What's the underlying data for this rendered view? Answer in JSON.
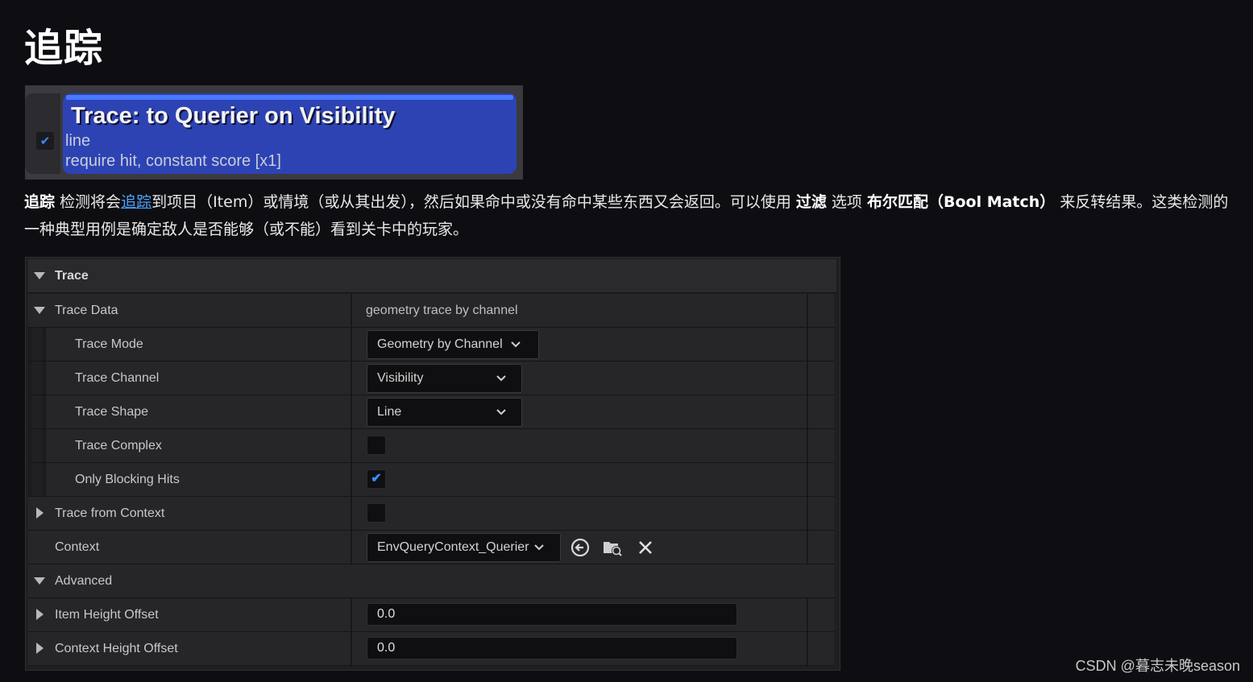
{
  "page": {
    "title": "追踪"
  },
  "node": {
    "title": "Trace: to Querier on Visibility",
    "line1": "line",
    "line2": "require hit, constant score [x1]",
    "checked": true
  },
  "description": {
    "p1": "追踪",
    "p2": " 检测将会",
    "link": "追踪",
    "p3": "到项目（Item）或情境（或从其出发），然后如果命中或没有命中某些东西又会返回。可以使用 ",
    "bold2": "过滤",
    "p4": " 选项 ",
    "bold3": "布尔匹配（Bool Match）",
    "p5": " 来反转结果。这类检测的一种典型用例是确定敌人是否能够（或不能）看到关卡中的玩家。"
  },
  "panel": {
    "section_trace": "Trace",
    "trace_data": {
      "label": "Trace Data",
      "value": "geometry trace by channel"
    },
    "trace_mode": {
      "label": "Trace Mode",
      "value": "Geometry by Channel"
    },
    "trace_channel": {
      "label": "Trace Channel",
      "value": "Visibility"
    },
    "trace_shape": {
      "label": "Trace Shape",
      "value": "Line"
    },
    "trace_complex": {
      "label": "Trace Complex",
      "checked": false
    },
    "only_blocking": {
      "label": "Only Blocking Hits",
      "checked": true
    },
    "trace_from_context": {
      "label": "Trace from Context",
      "checked": false
    },
    "context": {
      "label": "Context",
      "value": "EnvQueryContext_Querier"
    },
    "section_advanced": "Advanced",
    "item_height_offset": {
      "label": "Item Height Offset",
      "value": "0.0"
    },
    "context_height_offset": {
      "label": "Context Height Offset",
      "value": "0.0"
    }
  },
  "icons": {
    "check": "✔",
    "chevron": "chevron-down-icon",
    "use_selected": "arrow-left-circle-icon",
    "browse": "folder-search-icon",
    "clear": "close-icon"
  },
  "colors": {
    "node_blue": "#2d43b4",
    "check_blue": "#3b8cff",
    "link_blue": "#4ea1ff"
  },
  "watermark": "CSDN @暮志未晚season"
}
